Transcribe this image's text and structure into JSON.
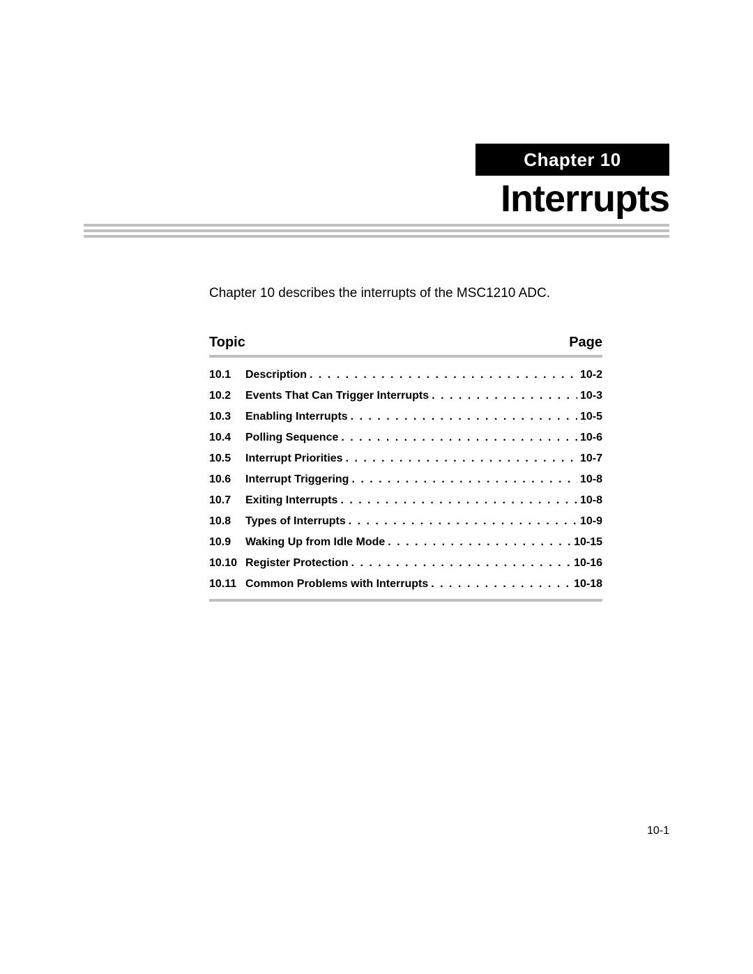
{
  "chapter_label": "Chapter 10",
  "title": "Interrupts",
  "intro": "Chapter 10 describes the interrupts of the MSC1210 ADC.",
  "toc_header": {
    "topic": "Topic",
    "page": "Page"
  },
  "toc": [
    {
      "num": "10.1",
      "title": "Description",
      "page": "10-2"
    },
    {
      "num": "10.2",
      "title": "Events That Can Trigger Interrupts",
      "page": "10-3"
    },
    {
      "num": "10.3",
      "title": "Enabling Interrupts",
      "page": "10-5"
    },
    {
      "num": "10.4",
      "title": "Polling Sequence",
      "page": "10-6"
    },
    {
      "num": "10.5",
      "title": "Interrupt Priorities",
      "page": "10-7"
    },
    {
      "num": "10.6",
      "title": "Interrupt Triggering",
      "page": "10-8"
    },
    {
      "num": "10.7",
      "title": "Exiting Interrupts",
      "page": "10-8"
    },
    {
      "num": "10.8",
      "title": "Types of Interrupts",
      "page": "10-9"
    },
    {
      "num": "10.9",
      "title": "Waking Up from Idle Mode",
      "page": "10-15"
    },
    {
      "num": "10.10",
      "title": "Register Protection",
      "page": "10-16"
    },
    {
      "num": "10.11",
      "title": "Common Problems with Interrupts",
      "page": "10-18"
    }
  ],
  "page_number": "10-1"
}
